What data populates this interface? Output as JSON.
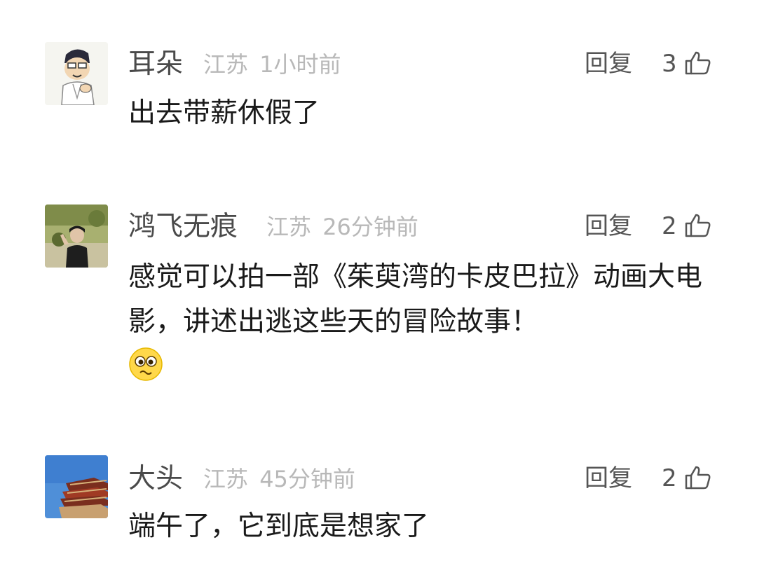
{
  "comments": [
    {
      "username": "耳朵",
      "location": "江苏",
      "time": "1小时前",
      "reply_label": "回复",
      "likes": "3",
      "text": "出去带薪休假了",
      "avatar_icon": "cartoon-character-avatar"
    },
    {
      "username": "鸿飞无痕",
      "location": "江苏",
      "time": "26分钟前",
      "reply_label": "回复",
      "likes": "2",
      "text": "感觉可以拍一部《茱萸湾的卡皮巴拉》动画大电影，讲述出逃这些天的冒险故事！",
      "emoji": "pleading-face-emoji",
      "avatar_icon": "person-photo-avatar"
    },
    {
      "username": "大头",
      "location": "江苏",
      "time": "45分钟前",
      "reply_label": "回复",
      "likes": "2",
      "text": "端午了，它到底是想家了",
      "avatar_icon": "pagoda-photo-avatar"
    }
  ],
  "colors": {
    "username": "#4a4a4a",
    "meta": "#b8b8b8",
    "content": "#1a1a1a",
    "action": "#555555"
  }
}
